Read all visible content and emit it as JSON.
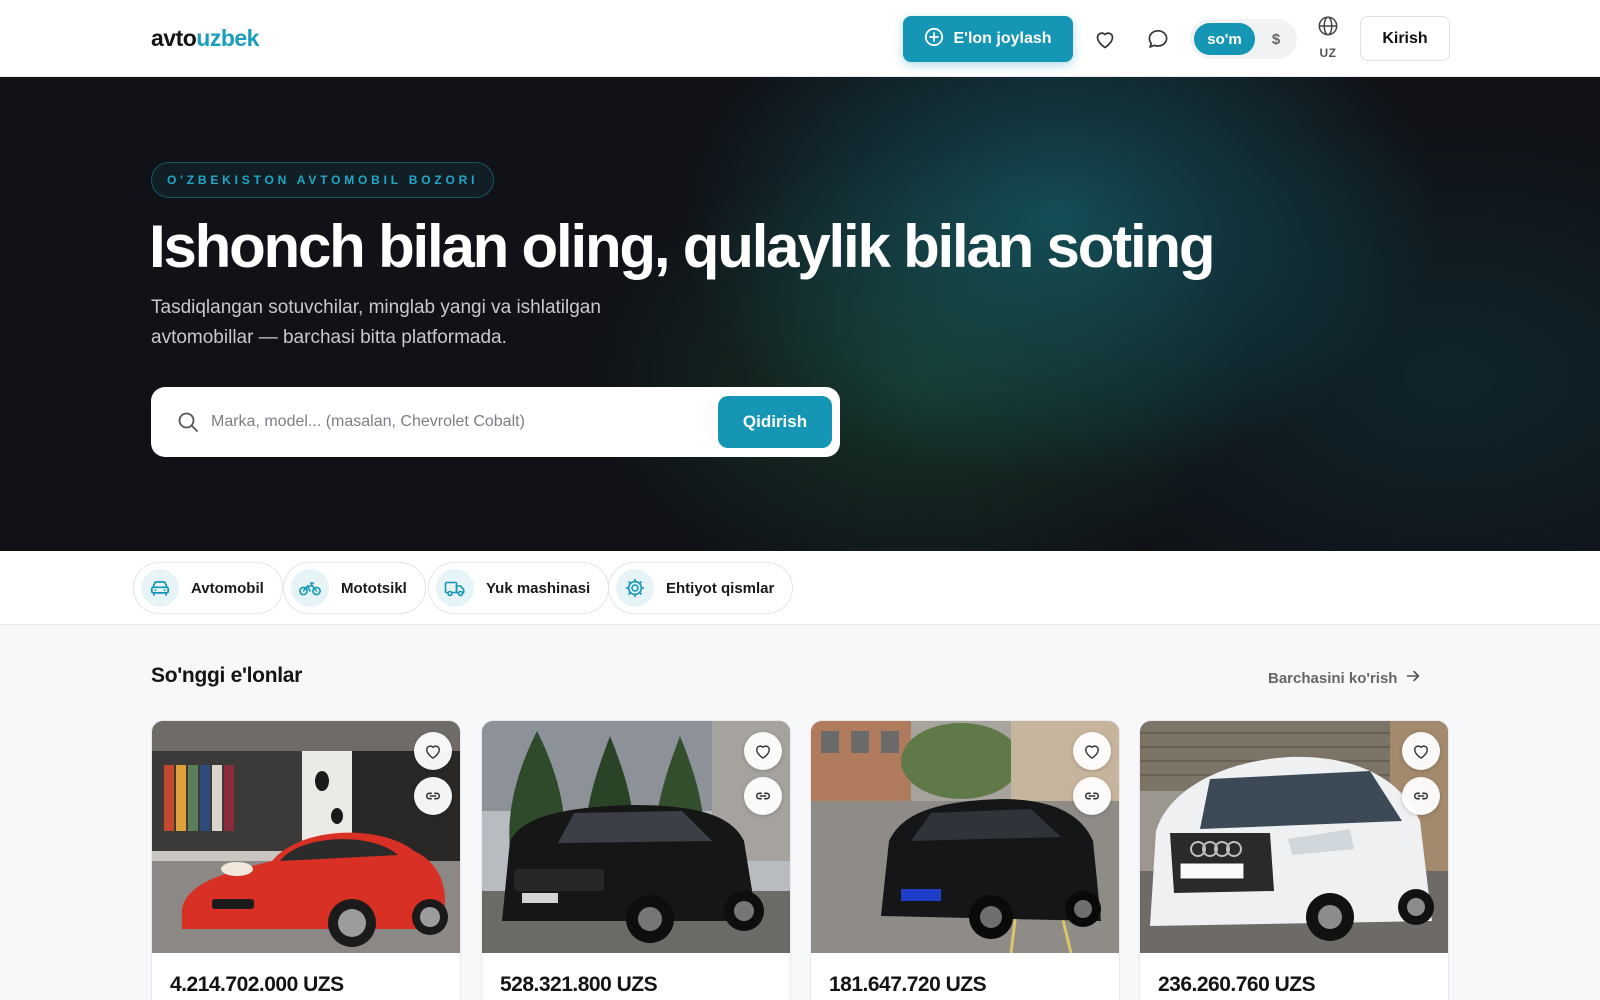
{
  "header": {
    "logo_part1": "avto",
    "logo_part2": "uzbek",
    "post_ad_label": "E'lon joylash",
    "currency_som": "so'm",
    "currency_usd": "$",
    "language": "UZ",
    "login_label": "Kirish"
  },
  "hero": {
    "badge": "O'ZBEKISTON AVTOMOBIL BOZORI",
    "title": "Ishonch bilan oling, qulaylik bilan soting",
    "subtitle": "Tasdiqlangan sotuvchilar, minglab yangi va ishlatilgan avtomobillar — barchasi bitta platformada.",
    "search_placeholder": "Marka, model... (masalan, Chevrolet Cobalt)",
    "search_button": "Qidirish"
  },
  "categories": [
    {
      "label": "Avtomobil",
      "icon": "car-icon"
    },
    {
      "label": "Mototsikl",
      "icon": "motorcycle-icon"
    },
    {
      "label": "Yuk mashinasi",
      "icon": "truck-icon"
    },
    {
      "label": "Ehtiyot qismlar",
      "icon": "gear-icon"
    }
  ],
  "listings": {
    "title": "So'nggi e'lonlar",
    "see_all": "Barchasini ko'rish",
    "items": [
      {
        "price": "4.214.702.000 UZS",
        "car_color": "#d93025",
        "scene": "showroom"
      },
      {
        "price": "528.321.800 UZS",
        "car_color": "#161616",
        "scene": "trees"
      },
      {
        "price": "181.647.720 UZS",
        "car_color": "#141618",
        "scene": "parking"
      },
      {
        "price": "236.260.760 UZS",
        "car_color": "#eef0f2",
        "scene": "street"
      }
    ]
  },
  "colors": {
    "accent": "#1496b4",
    "hero_bg": "#101217"
  }
}
